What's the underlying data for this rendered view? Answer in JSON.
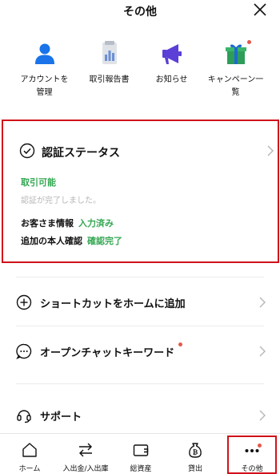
{
  "header": {
    "title": "その他",
    "close_icon": "close-icon"
  },
  "shortcuts": [
    {
      "label": "アカウントを\n管理",
      "icon": "person-icon"
    },
    {
      "label": "取引報告書",
      "icon": "report-icon"
    },
    {
      "label": "お知らせ",
      "icon": "megaphone-icon"
    },
    {
      "label": "キャンペーン一\n覧",
      "icon": "gift-icon",
      "badge": true
    }
  ],
  "verification": {
    "title": "認証ステータス",
    "trade_status": "取引可能",
    "message": "認証が完了しました。",
    "customer_info_label": "お客さま情報",
    "customer_info_value": "入力済み",
    "additional_id_label": "追加の本人確認",
    "additional_id_value": "確認完了"
  },
  "menu": {
    "shortcut": "ショートカットをホームに追加",
    "openchat": "オープンチャットキーワード",
    "support": "サポート"
  },
  "tabbar": [
    {
      "label": "ホーム",
      "icon": "home-icon"
    },
    {
      "label": "入出金/入出庫",
      "icon": "transfer-icon"
    },
    {
      "label": "総資産",
      "icon": "wallet-icon"
    },
    {
      "label": "貸出",
      "icon": "lending-icon"
    },
    {
      "label": "その他",
      "icon": "more-icon",
      "badge": true
    }
  ],
  "colors": {
    "accent_green": "#34a853",
    "highlight_red": "#d0111b",
    "badge_red": "#e25a4b",
    "icon_blue": "#1a73e8",
    "icon_purple": "#5b3fd6",
    "gift_green": "#2e9d5a"
  }
}
